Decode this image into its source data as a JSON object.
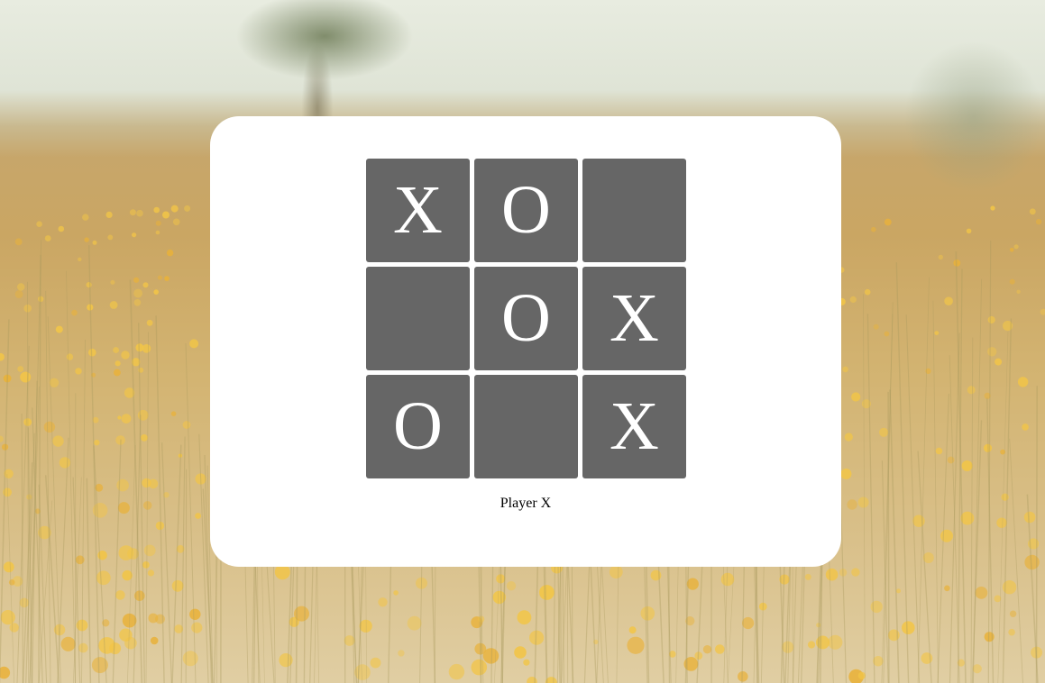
{
  "board": {
    "cells": [
      "X",
      "O",
      "",
      "",
      "O",
      "X",
      "O",
      "",
      "X"
    ]
  },
  "status": {
    "text": "Player X"
  },
  "colors": {
    "panel": "#ffffff",
    "cell": "#666666",
    "mark": "#ffffff"
  }
}
